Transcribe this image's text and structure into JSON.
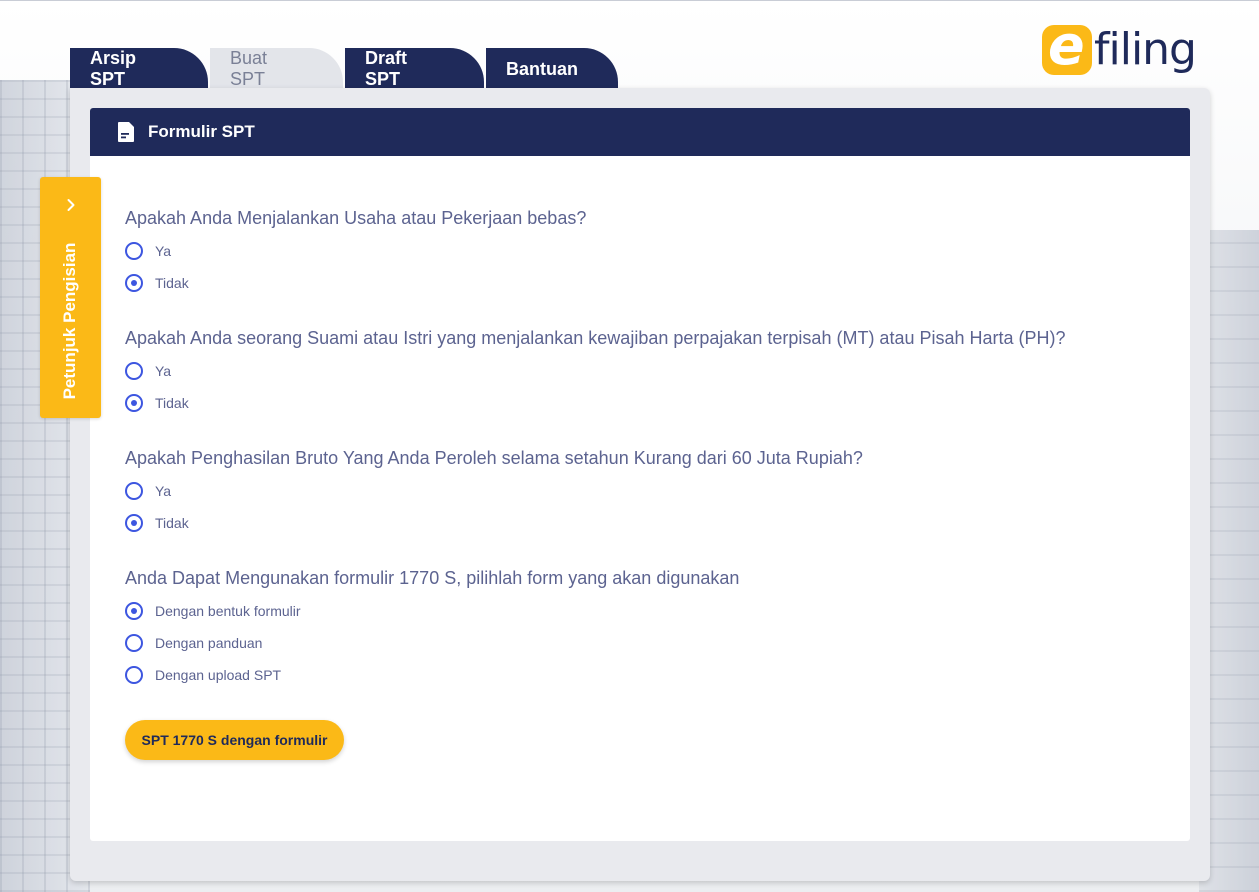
{
  "brand": {
    "logo_letter": "e",
    "logo_word": "filing"
  },
  "tabs": [
    {
      "label": "Arsip SPT",
      "active": false
    },
    {
      "label": "Buat SPT",
      "active": true
    },
    {
      "label": "Draft SPT",
      "active": false
    },
    {
      "label": "Bantuan",
      "active": false
    }
  ],
  "side_panel": {
    "label": "Petunjuk Pengisian",
    "icon": "chevron-right-icon"
  },
  "form": {
    "title": "Formulir SPT",
    "questions": [
      {
        "text": "Apakah Anda Menjalankan Usaha atau Pekerjaan bebas?",
        "options": [
          {
            "label": "Ya",
            "checked": false
          },
          {
            "label": "Tidak",
            "checked": true
          }
        ]
      },
      {
        "text": "Apakah Anda seorang Suami atau Istri yang menjalankan kewajiban perpajakan terpisah (MT) atau Pisah Harta (PH)?",
        "options": [
          {
            "label": "Ya",
            "checked": false
          },
          {
            "label": "Tidak",
            "checked": true
          }
        ]
      },
      {
        "text": "Apakah Penghasilan Bruto Yang Anda Peroleh selama setahun Kurang dari 60 Juta Rupiah?",
        "options": [
          {
            "label": "Ya",
            "checked": false
          },
          {
            "label": "Tidak",
            "checked": true
          }
        ]
      },
      {
        "text": "Anda Dapat Mengunakan formulir 1770 S, pilihlah form yang akan digunakan",
        "options": [
          {
            "label": "Dengan bentuk formulir",
            "checked": true
          },
          {
            "label": "Dengan panduan",
            "checked": false
          },
          {
            "label": "Dengan upload SPT",
            "checked": false
          }
        ]
      }
    ],
    "submit_label": "SPT 1770 S dengan formulir"
  },
  "colors": {
    "navy": "#1f2a5a",
    "accent_yellow": "#fbb917",
    "radio_blue": "#3d56e0",
    "text_muted": "#5c6390"
  }
}
